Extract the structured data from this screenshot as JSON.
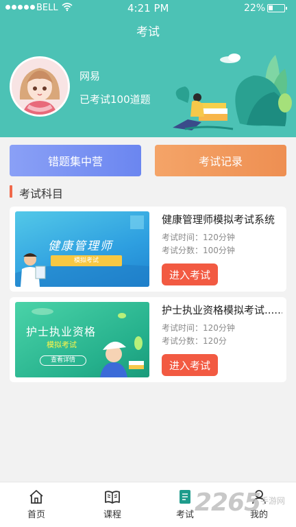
{
  "status_bar": {
    "carrier": "BELL",
    "time": "4:21 PM",
    "battery": "22%"
  },
  "header": {
    "title": "考试"
  },
  "user": {
    "name": "网易",
    "stats": "已考试100道题"
  },
  "actions": {
    "wrong_questions": "错题集中营",
    "exam_record": "考试记录"
  },
  "section": {
    "title": "考试科目"
  },
  "exams": [
    {
      "title": "健康管理师模拟考试系统",
      "time": "考试时间：120分钟",
      "score": "考试分数：100分钟",
      "button": "进入考试",
      "banner_title": "健康管理师",
      "banner_sub": "模拟考试"
    },
    {
      "title": "护士执业资格模拟考试......",
      "time": "考试时间：120分钟",
      "score": "考试分数：120分",
      "button": "进入考试",
      "banner_title": "护士执业资格",
      "banner_sub": "模拟考试",
      "banner_button": "查看详情"
    }
  ],
  "nav": [
    {
      "label": "首页",
      "icon": "home-icon"
    },
    {
      "label": "课程",
      "icon": "book-icon"
    },
    {
      "label": "考试",
      "icon": "exam-icon",
      "active": true
    },
    {
      "label": "我的",
      "icon": "user-icon"
    }
  ],
  "watermark": {
    "number": "2265",
    "text": "手游网"
  },
  "colors": {
    "header": "#4cc2b5",
    "accent": "#f25a42",
    "blue_button": "#6b86f0",
    "orange_button": "#ee8f52"
  }
}
